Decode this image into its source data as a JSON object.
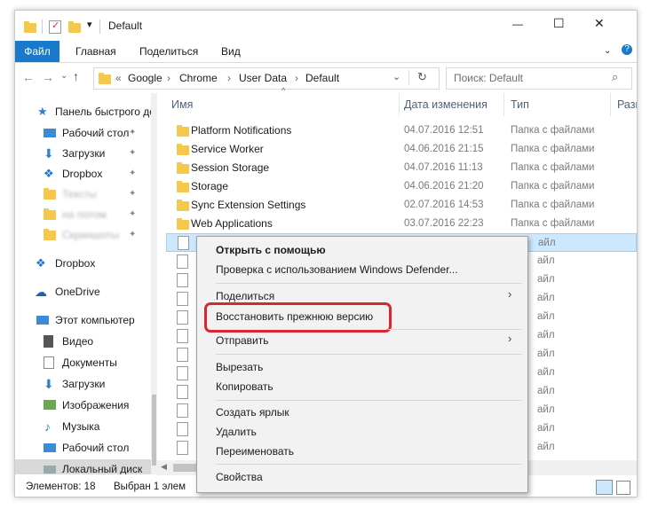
{
  "window": {
    "title": "Default",
    "controls": {
      "minimize": "—",
      "maximize": "☐",
      "close": "✕"
    }
  },
  "ribbon": {
    "tabs": [
      {
        "label": "Файл",
        "active": true
      },
      {
        "label": "Главная"
      },
      {
        "label": "Поделиться"
      },
      {
        "label": "Вид"
      }
    ],
    "help_icon": "?"
  },
  "address": {
    "path": [
      "«",
      "Google",
      "Chrome",
      "User Data",
      "Default"
    ],
    "search_placeholder": "Поиск: Default"
  },
  "nav": {
    "items": [
      {
        "label": "Панель быстрого доступа",
        "icon": "star-icon",
        "pinned": false
      },
      {
        "label": "Рабочий стол",
        "icon": "desktop-icon",
        "pinned": true
      },
      {
        "label": "Загрузки",
        "icon": "downloads-icon",
        "pinned": true
      },
      {
        "label": "Dropbox",
        "icon": "dropbox-icon",
        "pinned": true
      },
      {
        "label": "Тексты",
        "icon": "folder-icon",
        "pinned": true,
        "blurred": true
      },
      {
        "label": "на потом",
        "icon": "folder-icon",
        "pinned": true,
        "blurred": true
      },
      {
        "label": "Скриншоты",
        "icon": "folder-icon",
        "pinned": true,
        "blurred": true
      },
      {
        "label": "Dropbox",
        "icon": "dropbox-icon",
        "pinned": false
      },
      {
        "label": "OneDrive",
        "icon": "onedrive-icon",
        "pinned": false
      },
      {
        "label": "Этот компьютер",
        "icon": "computer-icon",
        "pinned": false
      },
      {
        "label": "Видео",
        "icon": "video-icon",
        "pinned": false
      },
      {
        "label": "Документы",
        "icon": "documents-icon",
        "pinned": false
      },
      {
        "label": "Загрузки",
        "icon": "downloads-icon",
        "pinned": false
      },
      {
        "label": "Изображения",
        "icon": "pictures-icon",
        "pinned": false
      },
      {
        "label": "Музыка",
        "icon": "music-icon",
        "pinned": false
      },
      {
        "label": "Рабочий стол",
        "icon": "desktop-icon",
        "pinned": false
      },
      {
        "label": "Локальный диск",
        "icon": "disk-icon",
        "pinned": false
      }
    ]
  },
  "columns": {
    "name": "Имя",
    "date": "Дата изменения",
    "type": "Тип",
    "size": "Разм"
  },
  "files": [
    {
      "name": "Platform Notifications",
      "date": "04.07.2016 12:51",
      "type": "Папка с файлами"
    },
    {
      "name": "Service Worker",
      "date": "04.06.2016 21:15",
      "type": "Папка с файлами"
    },
    {
      "name": "Session Storage",
      "date": "04.07.2016 11:13",
      "type": "Папка с файлами"
    },
    {
      "name": "Storage",
      "date": "04.06.2016 21:20",
      "type": "Папка с файлами"
    },
    {
      "name": "Sync Extension Settings",
      "date": "02.07.2016 14:53",
      "type": "Папка с файлами"
    },
    {
      "name": "Web Applications",
      "date": "03.07.2016 22:23",
      "type": "Папка с файлами"
    }
  ],
  "file_rows_type_suffix": [
    "айл",
    "айл",
    "айл",
    "айл",
    "айл",
    "айл",
    "айл",
    "айл",
    "айл",
    "айл",
    "айл",
    "айл"
  ],
  "context_menu": {
    "open_with": "Открыть с помощью",
    "defender": "Проверка с использованием Windows Defender...",
    "share": "Поделиться",
    "restore": "Восстановить прежнюю версию",
    "send_to": "Отправить",
    "cut": "Вырезать",
    "copy": "Копировать",
    "shortcut": "Создать ярлык",
    "delete": "Удалить",
    "rename": "Переименовать",
    "properties": "Свойства",
    "highlight_color": "#d8282f"
  },
  "status": {
    "count": "Элементов: 18",
    "selected": "Выбран 1 элем"
  },
  "colors": {
    "accent": "#1979ca",
    "folder": "#f5c84b",
    "selection": "#cce8ff"
  }
}
